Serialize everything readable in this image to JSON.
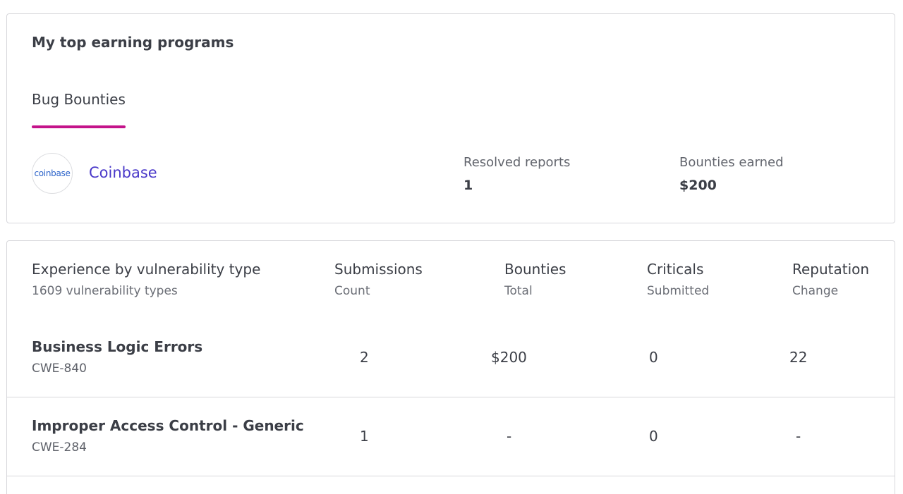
{
  "top_programs": {
    "title": "My top earning programs",
    "tab_label": "Bug Bounties",
    "program": {
      "logo_text": "coinbase",
      "name": "Coinbase",
      "resolved_reports_label": "Resolved reports",
      "resolved_reports_value": "1",
      "bounties_earned_label": "Bounties earned",
      "bounties_earned_value": "$200"
    }
  },
  "vulnerabilities": {
    "title": "Experience by vulnerability type",
    "subtitle": "1609 vulnerability types",
    "columns": [
      {
        "label": "Submissions",
        "sub": "Count"
      },
      {
        "label": "Bounties",
        "sub": "Total"
      },
      {
        "label": "Criticals",
        "sub": "Submitted"
      },
      {
        "label": "Reputation",
        "sub": "Change"
      }
    ],
    "rows": [
      {
        "name": "Business Logic Errors",
        "cwe": "CWE-840",
        "submissions": "2",
        "bounties": "$200",
        "criticals": "0",
        "reputation": "22"
      },
      {
        "name": "Improper Access Control - Generic",
        "cwe": "CWE-284",
        "submissions": "1",
        "bounties": "-",
        "criticals": "0",
        "reputation": "-"
      }
    ]
  },
  "colors": {
    "accent_tab": "#c4138a",
    "link": "#4a39c9",
    "border": "#d7d7db"
  }
}
